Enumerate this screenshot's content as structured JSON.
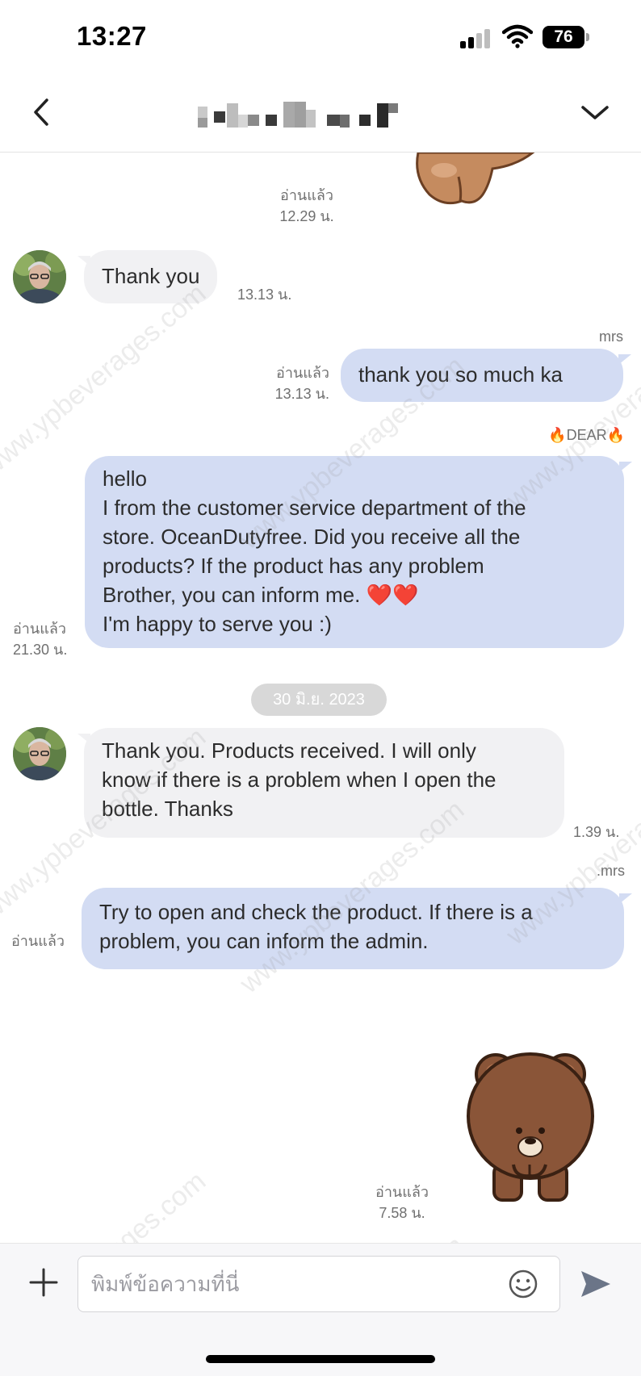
{
  "status_bar": {
    "time": "13:27",
    "battery": "76"
  },
  "header": {
    "back_icon": "chevron-left-icon",
    "dropdown_icon": "chevron-down-icon",
    "name_pixelated": true
  },
  "messages": {
    "m1": {
      "direction": "outgoing",
      "type": "sticker",
      "read_label": "อ่านแล้ว",
      "time": "12.29 น."
    },
    "m2": {
      "direction": "incoming",
      "text": "Thank you",
      "time": "13.13 น."
    },
    "m3": {
      "direction": "outgoing",
      "sender": "mrs",
      "text": "thank you so  much ka",
      "read_label": "อ่านแล้ว",
      "time": "13.13 น."
    },
    "m4": {
      "direction": "outgoing",
      "sender": "🔥DEAR🔥",
      "lines": [
        "hello",
        "I from the customer service department of the",
        "store. OceanDutyfree. Did you receive all the",
        "products? If the product has any problem",
        "Brother, you can inform me. ❤️❤️",
        "I'm happy to serve you :)"
      ],
      "read_label": "อ่านแล้ว",
      "time": "21.30 น."
    },
    "date_separator": "30 มิ.ย. 2023",
    "m5": {
      "direction": "incoming",
      "lines": [
        "Thank you. Products received. I will only",
        "know if there is a problem when I open the",
        "bottle. Thanks"
      ],
      "time": "1.39 น."
    },
    "m6": {
      "direction": "outgoing",
      "sender": ".mrs",
      "lines": [
        "Try to open and check the product. If there is a",
        "problem, you can inform the admin."
      ],
      "read_label": "อ่านแล้ว"
    },
    "m7": {
      "direction": "outgoing",
      "type": "sticker",
      "sticker": "brown-bear-bowing",
      "read_label": "อ่านแล้ว",
      "time": "7.58 น."
    }
  },
  "watermark": "www.ypbeverages.com",
  "input": {
    "placeholder": "พิมพ์ข้อความที่นี่",
    "value": ""
  },
  "icons": {
    "add": "plus-icon",
    "emoji": "smiley-icon",
    "send": "send-icon"
  },
  "colors": {
    "outgoing_bubble": "#d3dcf3",
    "incoming_bubble": "#f1f1f3",
    "date_pill": "#d8d8d8",
    "meta_text": "#707070"
  }
}
